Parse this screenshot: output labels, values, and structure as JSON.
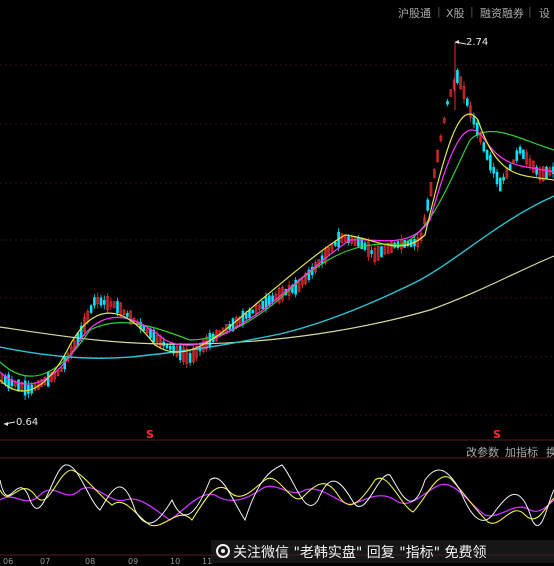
{
  "toolbar": {
    "items": [
      "沪股通",
      "X股",
      "融资融券",
      "设"
    ],
    "separator": "|"
  },
  "main_chart": {
    "high_label": "2.74",
    "low_label": "0.64",
    "signal_marks": [
      "S",
      "S"
    ]
  },
  "indicator_panel": {
    "buttons": [
      "改参数",
      "加指标",
      "换"
    ]
  },
  "x_axis": {
    "ticks": [
      "06",
      "07",
      "08",
      "09",
      "10",
      "11"
    ]
  },
  "watermark": {
    "text": "关注微信 \"老韩实盘\" 回复 \"指标\" 免费领"
  },
  "colors": {
    "background": "#000000",
    "up_candle": "#ff3333",
    "down_candle": "#00e5ff",
    "ma_yellow": "#e6e64a",
    "ma_magenta": "#ff33ff",
    "ma_green": "#33cc33",
    "ma_cyan": "#2ec4d6",
    "ma_long": "#d8d8a0",
    "signal": "#ff2a2a"
  }
}
